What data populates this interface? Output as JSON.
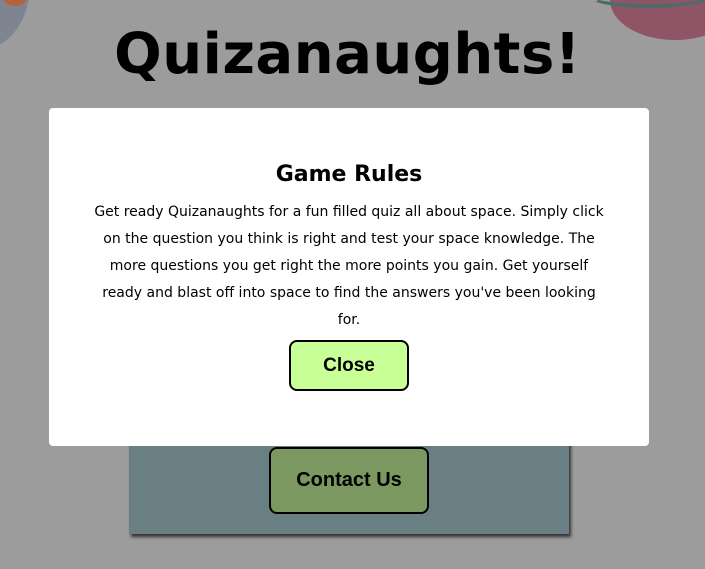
{
  "app": {
    "title": "Quizanaughts!"
  },
  "modal": {
    "title": "Game Rules",
    "body": "Get ready Quizanaughts for a fun filled quiz all about space. Simply click on the question you think is right and test your space knowledge. The more questions you get right the more points you gain. Get yourself ready and blast off into space to find the answers you've been looking for.",
    "close_label": "Close"
  },
  "menu": {
    "contact_label": "Contact Us"
  },
  "colors": {
    "overlay_background": "#9c9c9c",
    "modal_background": "#ffffff",
    "close_button": "#c8ff96",
    "menu_card": "#697f84",
    "contact_button": "#7a985f"
  }
}
